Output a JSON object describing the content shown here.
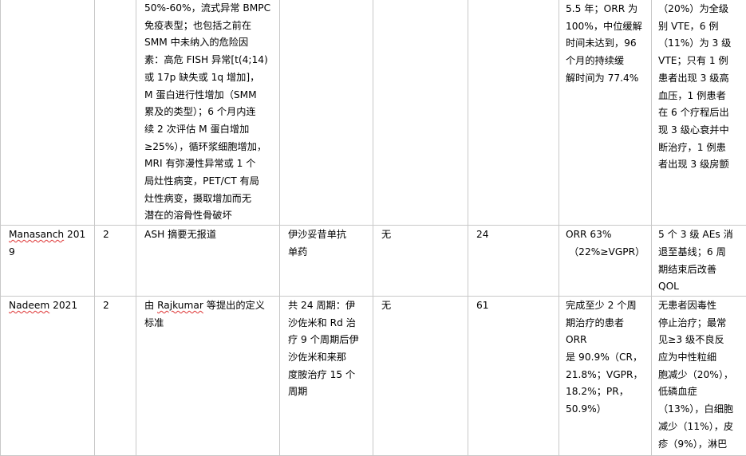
{
  "rows": [
    {
      "study": "",
      "phase": "",
      "definition_lines": [
        "50%-60%，流式异常 BMPC",
        "免疫表型；也包括之前在",
        "SMM 中未纳入的危险因",
        "素：高危 FISH 异常[t(4;14)",
        "或 17p 缺失或 1q 增加]，",
        "M 蛋白进行性增加（SMM",
        "累及的类型）；6 个月内连",
        "续 2 次评估 M 蛋白增加",
        "≥25%），循环浆细胞增加，",
        "MRI 有弥漫性异常或 1 个",
        "局灶性病变，PET/CT 有局",
        "灶性病变，摄取增加而无",
        "潜在的溶骨性骨破坏"
      ],
      "regimen": "",
      "control": "",
      "followup": "",
      "efficacy_lines": [
        "5.5 年；ORR 为",
        "100%，中位缓解",
        "时间未达到，96",
        "个月的持续缓",
        "解时间为 77.4%"
      ],
      "safety_lines": [
        "（20%）为全级",
        "别 VTE，6 例",
        "（11%）为 3 级",
        "VTE；只有 1 例",
        "患者出现 3 级高",
        "血压，1 例患者",
        "在 6 个疗程后出",
        "现 3 级心衰并中",
        "断治疗，1 例患",
        "者出现 3 级房颤"
      ]
    },
    {
      "study_name": "Manasanch",
      "study_year": "2019",
      "phase": "2",
      "definition_lines": [
        "ASH 摘要无报道"
      ],
      "regimen_lines": [
        "伊沙妥昔单抗",
        "单药"
      ],
      "control": "无",
      "followup": "24",
      "efficacy_lines": [
        "ORR 63%",
        "（22%≥VGPR）"
      ],
      "safety_lines": [
        "5 个 3 级 AEs 消",
        "退至基线；6 周",
        "期结束后改善",
        "QOL"
      ]
    },
    {
      "study_name": "Nadeem",
      "study_year": "2021",
      "phase": "2",
      "definition_lines": [
        "由 Rajkumar 等提出的定义",
        "标准"
      ],
      "regimen_lines": [
        "共 24 周期：伊",
        "沙佐米和 Rd 治",
        "疗 9 个周期后伊",
        "沙佐米和来那",
        "度胺治疗 15 个",
        "周期"
      ],
      "control": "无",
      "followup": "61",
      "efficacy_lines": [
        "完成至少 2 个周",
        "期治疗的患者",
        "ORR",
        "是 90.9%（CR，",
        "21.8%；VGPR，",
        "18.2%；PR，",
        "50.9%）"
      ],
      "safety_lines": [
        "无患者因毒性",
        "停止治疗；最常",
        "见≥3 级不良反",
        "应为中性粒细",
        "胞减少（20%），",
        "低磷血症",
        "（13%），白细胞",
        "减少（11%），皮",
        "疹（9%），淋巴"
      ]
    }
  ]
}
